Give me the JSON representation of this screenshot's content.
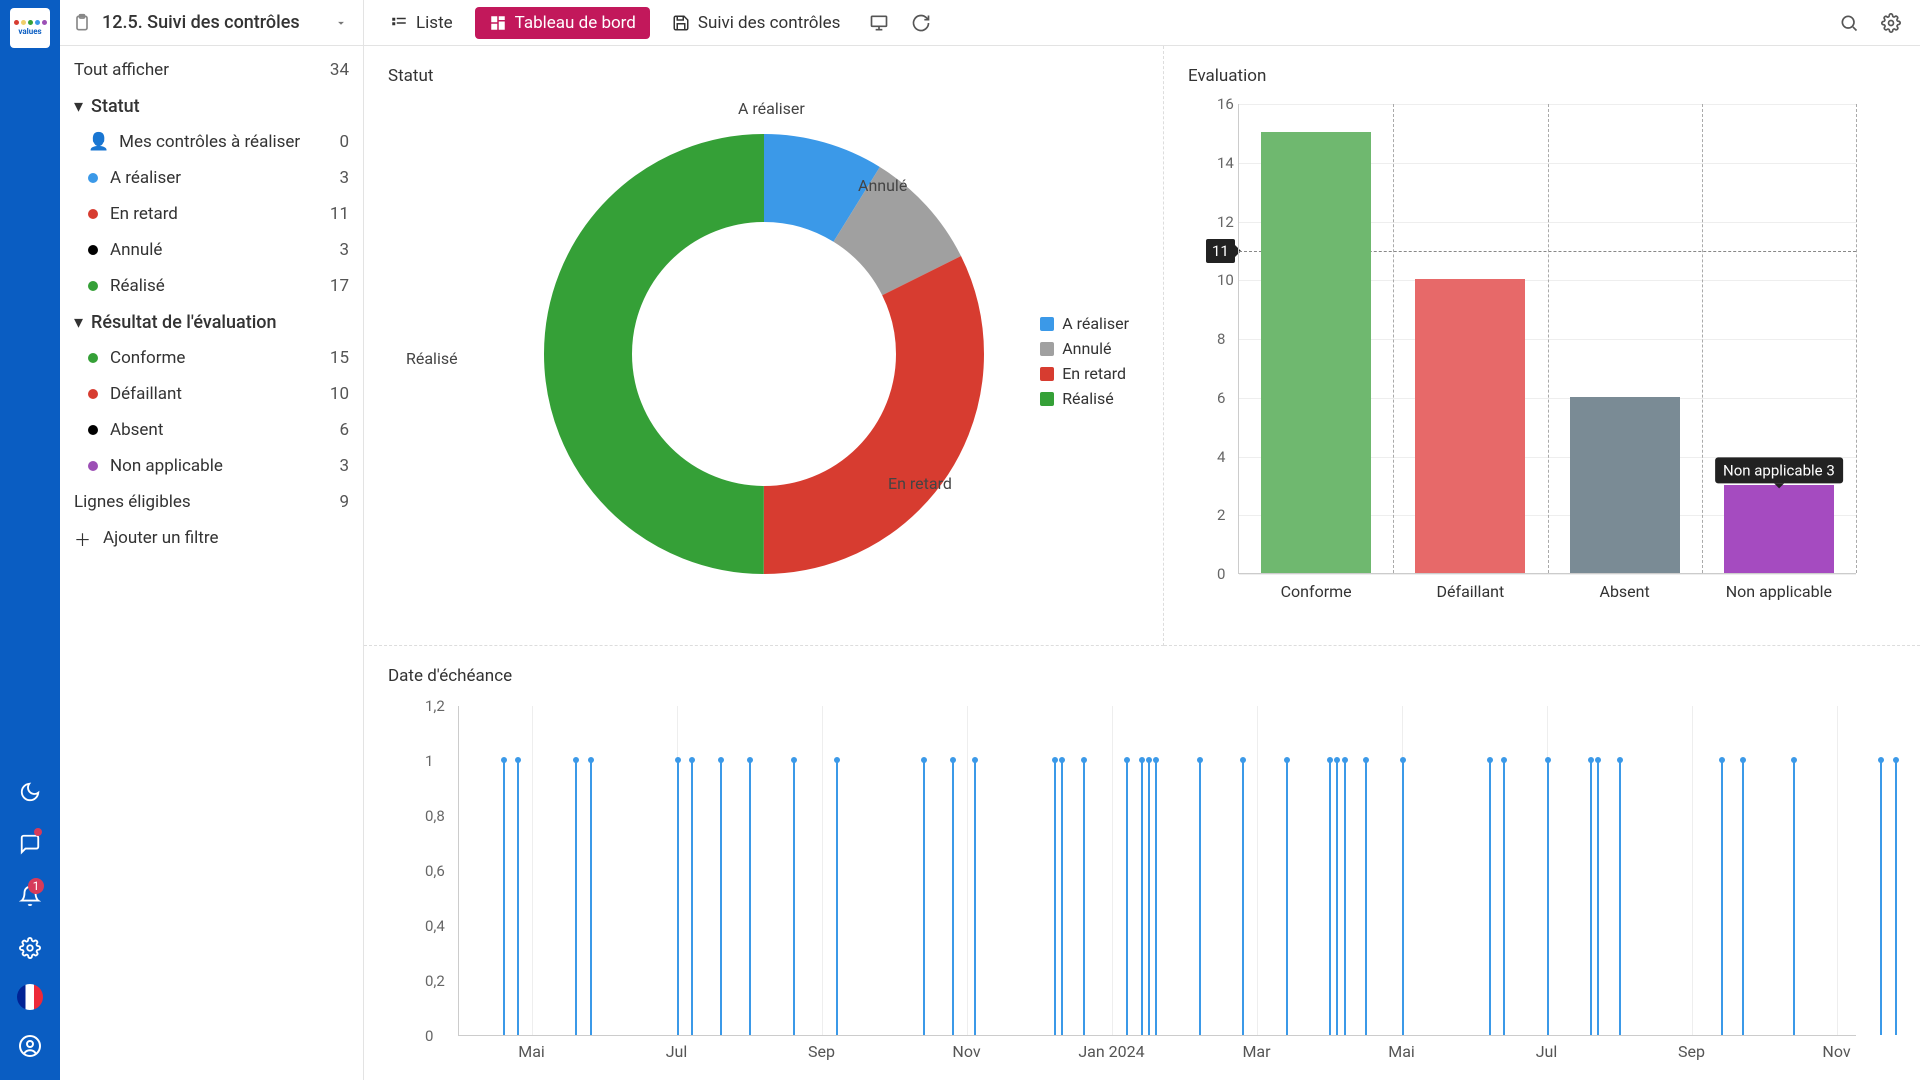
{
  "app": {
    "title": "12.5. Suivi des contrôles"
  },
  "tabs": {
    "liste": "Liste",
    "tableau": "Tableau de bord",
    "suivi": "Suivi des contrôles"
  },
  "sidebar": {
    "showall": {
      "label": "Tout afficher",
      "count": "34"
    },
    "group_status": "Statut",
    "status": [
      {
        "label": "Mes contrôles à réaliser",
        "count": "0",
        "color": "#f0ce6a",
        "emoji": true
      },
      {
        "label": "A réaliser",
        "count": "3",
        "color": "#3b99e8"
      },
      {
        "label": "En retard",
        "count": "11",
        "color": "#d73c30"
      },
      {
        "label": "Annulé",
        "count": "3",
        "color": "#000"
      },
      {
        "label": "Réalisé",
        "count": "17",
        "color": "#35a037"
      }
    ],
    "group_eval": "Résultat de l'évaluation",
    "eval": [
      {
        "label": "Conforme",
        "count": "15",
        "color": "#35a037"
      },
      {
        "label": "Défaillant",
        "count": "10",
        "color": "#d73c30"
      },
      {
        "label": "Absent",
        "count": "6",
        "color": "#000"
      },
      {
        "label": "Non applicable",
        "count": "3",
        "color": "#9c4fb5"
      }
    ],
    "eligible": {
      "label": "Lignes éligibles",
      "count": "9"
    },
    "add_filter": "Ajouter un filtre"
  },
  "charts": {
    "statut_title": "Statut",
    "eval_title": "Evaluation",
    "deadline_title": "Date d'échéance"
  },
  "chart_data": {
    "statut_donut": {
      "type": "pie",
      "title": "Statut",
      "series": [
        {
          "name": "A réaliser",
          "value": 3,
          "color": "#3b99e8"
        },
        {
          "name": "Annulé",
          "value": 3,
          "color": "#a0a0a0"
        },
        {
          "name": "En retard",
          "value": 11,
          "color": "#d73c30"
        },
        {
          "name": "Réalisé",
          "value": 17,
          "color": "#35a037"
        }
      ],
      "labels_outside": [
        "A réaliser",
        "Annulé",
        "En retard",
        "Réalisé"
      ]
    },
    "evaluation_bar": {
      "type": "bar",
      "title": "Evaluation",
      "categories": [
        "Conforme",
        "Défaillant",
        "Absent",
        "Non applicable"
      ],
      "values": [
        15,
        10,
        6,
        3
      ],
      "colors": [
        "#6fb86f",
        "#e76969",
        "#7a8b95",
        "#a54bc0"
      ],
      "ylim": [
        0,
        16
      ],
      "yticks": [
        0,
        2,
        4,
        6,
        8,
        10,
        12,
        14,
        16
      ],
      "reference_line": 11,
      "tooltip": {
        "category": "Non applicable",
        "value": 3,
        "text": "Non applicable 3"
      }
    },
    "deadline_line": {
      "type": "line",
      "title": "Date d'échéance",
      "ylim": [
        0,
        1.2
      ],
      "yticks": [
        0,
        0.2,
        0.4,
        0.6,
        0.8,
        1.0,
        1.2
      ],
      "xticks": [
        "Mai",
        "Jul",
        "Sep",
        "Nov",
        "Jan 2024",
        "Mar",
        "Mai",
        "Jul",
        "Sep",
        "Nov"
      ],
      "spike_positions_pct": [
        3,
        4,
        8,
        9,
        15,
        16,
        18,
        20,
        23,
        26,
        32,
        34,
        35.5,
        41,
        41.5,
        43,
        46,
        47,
        47.5,
        48,
        51,
        54,
        57,
        60,
        60.5,
        61,
        62.5,
        65,
        71,
        72,
        75,
        78,
        78.5,
        80,
        87,
        88.5,
        92,
        98,
        99
      ],
      "spike_value": 1
    }
  },
  "tooltip": {
    "bar": "Non applicable 3",
    "axis": "11"
  }
}
